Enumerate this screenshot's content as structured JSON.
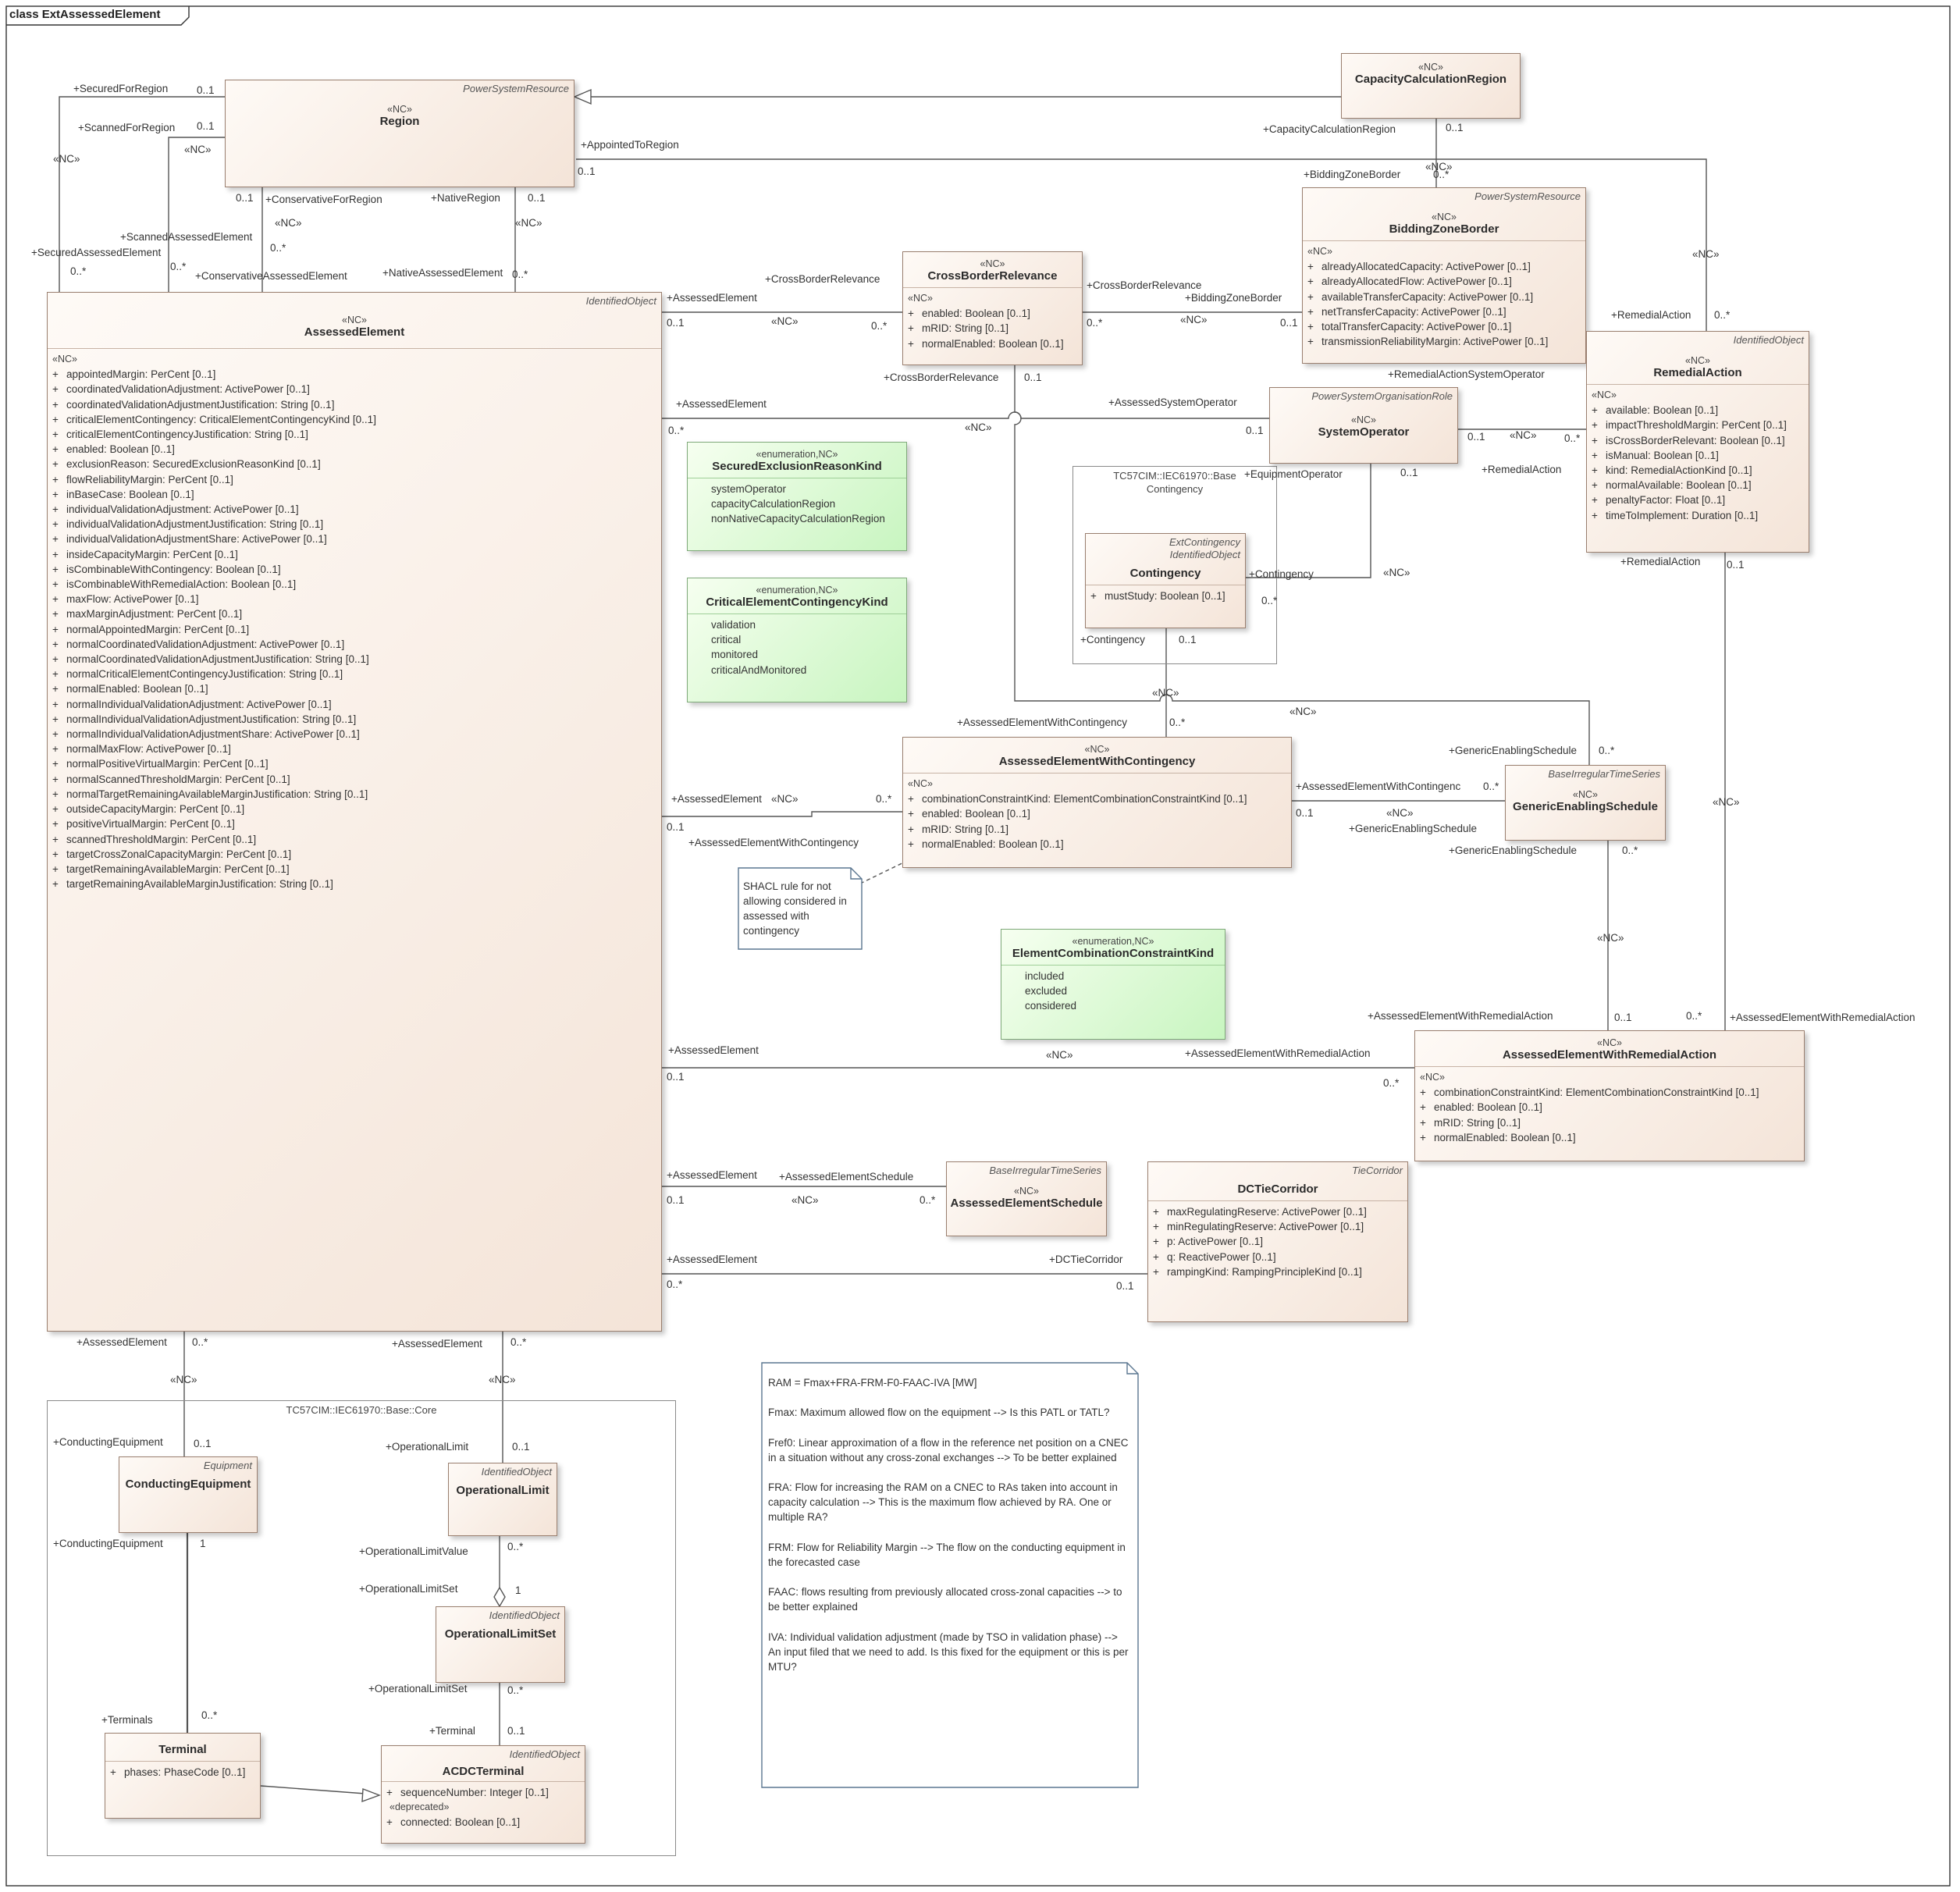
{
  "diagram_title": "class ExtAssessedElement",
  "classes": {
    "region": {
      "parent": "PowerSystemResource",
      "stereotype": "«NC»",
      "name": "Region"
    },
    "ccr": {
      "stereotype": "«NC»",
      "name": "CapacityCalculationRegion"
    },
    "bzb": {
      "parent": "PowerSystemResource",
      "stereotype": "«NC»",
      "name": "BiddingZoneBorder",
      "sec_stereo": "«NC»",
      "attrs": [
        {
          "vis": "+",
          "text": "alreadyAllocatedCapacity: ActivePower [0..1]"
        },
        {
          "vis": "+",
          "text": "alreadyAllocatedFlow: ActivePower [0..1]"
        },
        {
          "vis": "+",
          "text": "availableTransferCapacity: ActivePower [0..1]"
        },
        {
          "vis": "+",
          "text": "netTransferCapacity: ActivePower [0..1]"
        },
        {
          "vis": "+",
          "text": "totalTransferCapacity: ActivePower [0..1]"
        },
        {
          "vis": "+",
          "text": "transmissionReliabilityMargin: ActivePower [0..1]"
        }
      ]
    },
    "cbr": {
      "stereotype": "«NC»",
      "name": "CrossBorderRelevance",
      "sec_stereo": "«NC»",
      "attrs": [
        {
          "vis": "+",
          "text": "enabled: Boolean [0..1]"
        },
        {
          "vis": "+",
          "text": "mRID: String [0..1]"
        },
        {
          "vis": "+",
          "text": "normalEnabled: Boolean [0..1]"
        }
      ]
    },
    "ra": {
      "parent": "IdentifiedObject",
      "stereotype": "«NC»",
      "name": "RemedialAction",
      "sec_stereo": "«NC»",
      "attrs": [
        {
          "vis": "+",
          "text": "available: Boolean [0..1]"
        },
        {
          "vis": "+",
          "text": "impactThresholdMargin: PerCent [0..1]"
        },
        {
          "vis": "+",
          "text": "isCrossBorderRelevant: Boolean [0..1]"
        },
        {
          "vis": "+",
          "text": "isManual: Boolean [0..1]"
        },
        {
          "vis": "+",
          "text": "kind: RemedialActionKind [0..1]"
        },
        {
          "vis": "+",
          "text": "normalAvailable: Boolean [0..1]"
        },
        {
          "vis": "+",
          "text": "penaltyFactor: Float [0..1]"
        },
        {
          "vis": "+",
          "text": "timeToImplement: Duration [0..1]"
        }
      ]
    },
    "so": {
      "parent": "PowerSystemOrganisationRole",
      "stereotype": "«NC»",
      "name": "SystemOperator"
    },
    "ae": {
      "parent": "IdentifiedObject",
      "stereotype": "«NC»",
      "name": "AssessedElement",
      "sec_stereo": "«NC»",
      "attrs": [
        {
          "vis": "+",
          "text": "appointedMargin: PerCent [0..1]"
        },
        {
          "vis": "+",
          "text": "coordinatedValidationAdjustment: ActivePower [0..1]"
        },
        {
          "vis": "+",
          "text": "coordinatedValidationAdjustmentJustification: String [0..1]"
        },
        {
          "vis": "+",
          "text": "criticalElementContingency: CriticalElementContingencyKind [0..1]"
        },
        {
          "vis": "+",
          "text": "criticalElementContingencyJustification: String [0..1]"
        },
        {
          "vis": "+",
          "text": "enabled: Boolean [0..1]"
        },
        {
          "vis": "+",
          "text": "exclusionReason: SecuredExclusionReasonKind [0..1]"
        },
        {
          "vis": "+",
          "text": "flowReliabilityMargin: PerCent [0..1]"
        },
        {
          "vis": "+",
          "text": "inBaseCase: Boolean [0..1]"
        },
        {
          "vis": "+",
          "text": "individualValidationAdjustment: ActivePower [0..1]"
        },
        {
          "vis": "+",
          "text": "individualValidationAdjustmentJustification: String [0..1]"
        },
        {
          "vis": "+",
          "text": "individualValidationAdjustmentShare: ActivePower [0..1]"
        },
        {
          "vis": "+",
          "text": "insideCapacityMargin: PerCent [0..1]"
        },
        {
          "vis": "+",
          "text": "isCombinableWithContingency: Boolean [0..1]"
        },
        {
          "vis": "+",
          "text": "isCombinableWithRemedialAction: Boolean [0..1]"
        },
        {
          "vis": "+",
          "text": "maxFlow: ActivePower [0..1]"
        },
        {
          "vis": "+",
          "text": "maxMarginAdjustment: PerCent [0..1]"
        },
        {
          "vis": "+",
          "text": "normalAppointedMargin: PerCent [0..1]"
        },
        {
          "vis": "+",
          "text": "normalCoordinatedValidationAdjustment: ActivePower [0..1]"
        },
        {
          "vis": "+",
          "text": "normalCoordinatedValidationAdjustmentJustification: String [0..1]"
        },
        {
          "vis": "+",
          "text": "normalCriticalElementContingencyJustification: String [0..1]"
        },
        {
          "vis": "+",
          "text": "normalEnabled: Boolean [0..1]"
        },
        {
          "vis": "+",
          "text": "normalIndividualValidationAdjustment: ActivePower [0..1]"
        },
        {
          "vis": "+",
          "text": "normalIndividualValidationAdjustmentJustification: String [0..1]"
        },
        {
          "vis": "+",
          "text": "normalIndividualValidationAdjustmentShare: ActivePower [0..1]"
        },
        {
          "vis": "+",
          "text": "normalMaxFlow: ActivePower [0..1]"
        },
        {
          "vis": "+",
          "text": "normalPositiveVirtualMargin: PerCent [0..1]"
        },
        {
          "vis": "+",
          "text": "normalScannedThresholdMargin: PerCent [0..1]"
        },
        {
          "vis": "+",
          "text": "normalTargetRemainingAvailableMarginJustification: String [0..1]"
        },
        {
          "vis": "+",
          "text": "outsideCapacityMargin: PerCent [0..1]"
        },
        {
          "vis": "+",
          "text": "positiveVirtualMargin: PerCent [0..1]"
        },
        {
          "vis": "+",
          "text": "scannedThresholdMargin: PerCent [0..1]"
        },
        {
          "vis": "+",
          "text": "targetCrossZonalCapacityMargin: PerCent [0..1]"
        },
        {
          "vis": "+",
          "text": "targetRemainingAvailableMargin: PerCent [0..1]"
        },
        {
          "vis": "+",
          "text": "targetRemainingAvailableMarginJustification: String [0..1]"
        }
      ]
    },
    "sek": {
      "stereotype": "«enumeration,NC»",
      "name": "SecuredExclusionReasonKind",
      "literals": [
        "systemOperator",
        "capacityCalculationRegion",
        "nonNativeCapacityCalculationRegion"
      ]
    },
    "cek": {
      "stereotype": "«enumeration,NC»",
      "name": "CriticalElementContingencyKind",
      "literals": [
        "validation",
        "critical",
        "monitored",
        "criticalAndMonitored"
      ]
    },
    "cont": {
      "parent": "ExtContingency",
      "parent2": "IdentifiedObject",
      "name": "Contingency",
      "attrs": [
        {
          "vis": "+",
          "text": "mustStudy: Boolean [0..1]"
        }
      ]
    },
    "aewc": {
      "stereotype": "«NC»",
      "name": "AssessedElementWithContingency",
      "sec_stereo": "«NC»",
      "attrs": [
        {
          "vis": "+",
          "text": "combinationConstraintKind: ElementCombinationConstraintKind [0..1]"
        },
        {
          "vis": "+",
          "text": "enabled: Boolean [0..1]"
        },
        {
          "vis": "+",
          "text": "mRID: String [0..1]"
        },
        {
          "vis": "+",
          "text": "normalEnabled: Boolean [0..1]"
        }
      ]
    },
    "ges": {
      "parent": "BaseIrregularTimeSeries",
      "stereotype": "«NC»",
      "name": "GenericEnablingSchedule"
    },
    "ecck": {
      "stereotype": "«enumeration,NC»",
      "name": "ElementCombinationConstraintKind",
      "literals": [
        "included",
        "excluded",
        "considered"
      ]
    },
    "aewra": {
      "stereotype": "«NC»",
      "name": "AssessedElementWithRemedialAction",
      "sec_stereo": "«NC»",
      "attrs": [
        {
          "vis": "+",
          "text": "combinationConstraintKind: ElementCombinationConstraintKind [0..1]"
        },
        {
          "vis": "+",
          "text": "enabled: Boolean [0..1]"
        },
        {
          "vis": "+",
          "text": "mRID: String [0..1]"
        },
        {
          "vis": "+",
          "text": "normalEnabled: Boolean [0..1]"
        }
      ]
    },
    "aes": {
      "parent": "BaseIrregularTimeSeries",
      "stereotype": "«NC»",
      "name": "AssessedElementSchedule"
    },
    "dctc": {
      "parent": "TieCorridor",
      "name": "DCTieCorridor",
      "attrs": [
        {
          "vis": "+",
          "text": "maxRegulatingReserve: ActivePower [0..1]"
        },
        {
          "vis": "+",
          "text": "minRegulatingReserve: ActivePower [0..1]"
        },
        {
          "vis": "+",
          "text": "p: ActivePower [0..1]"
        },
        {
          "vis": "+",
          "text": "q: ReactivePower [0..1]"
        },
        {
          "vis": "+",
          "text": "rampingKind: RampingPrincipleKind [0..1]"
        }
      ]
    },
    "ce": {
      "parent": "Equipment",
      "name": "ConductingEquipment"
    },
    "ol": {
      "parent": "IdentifiedObject",
      "name": "OperationalLimit"
    },
    "ols": {
      "parent": "IdentifiedObject",
      "name": "OperationalLimitSet"
    },
    "term": {
      "name": "Terminal",
      "attrs": [
        {
          "vis": "+",
          "text": "phases: PhaseCode [0..1]"
        }
      ]
    },
    "acdc": {
      "parent": "IdentifiedObject",
      "name": "ACDCTerminal",
      "attrs": [
        {
          "vis": "+",
          "text": "sequenceNumber: Integer [0..1]"
        }
      ],
      "deprecated_stereo": "«deprecated»",
      "attrs2": [
        {
          "vis": "+",
          "text": "connected: Boolean [0..1]"
        }
      ]
    }
  },
  "packages": {
    "base_contingency": {
      "line1": "TC57CIM::IEC61970::Base",
      "line2": "Contingency"
    },
    "base_core": {
      "title": "TC57CIM::IEC61970::Base::Core"
    }
  },
  "notes": {
    "shacl": "SHACL rule for not allowing considered in assessed with contingency",
    "ram": [
      "RAM = Fmax+FRA-FRM-F0-FAAC-IVA [MW]",
      "Fmax: Maximum allowed flow on the equipment --> Is this PATL or TATL?",
      "Fref0: Linear approximation of a flow in the reference net position on a CNEC in a situation without any cross-zonal exchanges --> To be better explained",
      "FRA: Flow for increasing the RAM on a CNEC to RAs taken into account in capacity calculation -->  This is the maximum flow achieved by RA. One or multiple RA?",
      "FRM: Flow for Reliability Margin --> The flow on the conducting equipment in the forecasted case",
      "FAAC: flows resulting from previously allocated cross-zonal capacities --> to be better explained",
      "IVA: Individual validation adjustment (made by TSO in validation phase) --> An input filed that we need to add. Is this fixed for the equipment or this is per MTU?"
    ]
  },
  "labels": [
    {
      "t": "+SecuredForRegion",
      "n": "role"
    },
    {
      "t": "0..1",
      "n": "mult"
    },
    {
      "t": "+ScannedForRegion",
      "n": "role"
    },
    {
      "t": "0..1",
      "n": "mult"
    },
    {
      "t": "«NC»",
      "n": "stereo"
    },
    {
      "t": "«NC»",
      "n": "stereo"
    },
    {
      "t": "+SecuredAssessedElement",
      "n": "role"
    },
    {
      "t": "0..*",
      "n": "mult"
    },
    {
      "t": "+ScannedAssessedElement",
      "n": "role"
    },
    {
      "t": "0..*",
      "n": "mult"
    },
    {
      "t": "0..1",
      "n": "mult"
    },
    {
      "t": "+ConservativeForRegion",
      "n": "role"
    },
    {
      "t": "«NC»",
      "n": "stereo"
    },
    {
      "t": "0..*",
      "n": "mult"
    },
    {
      "t": "+ConservativeAssessedElement",
      "n": "role"
    },
    {
      "t": "+NativeRegion",
      "n": "role"
    },
    {
      "t": "0..1",
      "n": "mult"
    },
    {
      "t": "«NC»",
      "n": "stereo"
    },
    {
      "t": "+NativeAssessedElement",
      "n": "role"
    },
    {
      "t": "0..*",
      "n": "mult"
    },
    {
      "t": "+AppointedToRegion",
      "n": "role"
    },
    {
      "t": "0..1",
      "n": "mult"
    },
    {
      "t": "+CapacityCalculationRegion",
      "n": "role"
    },
    {
      "t": "0..1",
      "n": "mult"
    },
    {
      "t": "«NC»",
      "n": "stereo"
    },
    {
      "t": "+BiddingZoneBorder",
      "n": "role"
    },
    {
      "t": "0..*",
      "n": "mult"
    },
    {
      "t": "«NC»",
      "n": "stereo"
    },
    {
      "t": "+AssessedElement",
      "n": "role"
    },
    {
      "t": "0..1",
      "n": "mult"
    },
    {
      "t": "+CrossBorderRelevance",
      "n": "role"
    },
    {
      "t": "«NC»",
      "n": "stereo"
    },
    {
      "t": "0..*",
      "n": "mult"
    },
    {
      "t": "+CrossBorderRelevance",
      "n": "role"
    },
    {
      "t": "0..*",
      "n": "mult"
    },
    {
      "t": "+BiddingZoneBorder",
      "n": "role"
    },
    {
      "t": "«NC»",
      "n": "stereo"
    },
    {
      "t": "0..1",
      "n": "mult"
    },
    {
      "t": "+CrossBorderRelevance",
      "n": "role"
    },
    {
      "t": "0..1",
      "n": "mult"
    },
    {
      "t": "+RemedialAction",
      "n": "role"
    },
    {
      "t": "0..*",
      "n": "mult"
    },
    {
      "t": "+RemedialActionSystemOperator",
      "n": "role"
    },
    {
      "t": "+AssessedElement",
      "n": "role"
    },
    {
      "t": "0..*",
      "n": "mult"
    },
    {
      "t": "«NC»",
      "n": "stereo"
    },
    {
      "t": "+AssessedSystemOperator",
      "n": "role"
    },
    {
      "t": "0..1",
      "n": "mult"
    },
    {
      "t": "0..1",
      "n": "mult"
    },
    {
      "t": "«NC»",
      "n": "stereo"
    },
    {
      "t": "0..*",
      "n": "mult"
    },
    {
      "t": "+RemedialAction",
      "n": "role"
    },
    {
      "t": "+EquipmentOperator",
      "n": "role"
    },
    {
      "t": "0..1",
      "n": "mult"
    },
    {
      "t": "+Contingency",
      "n": "role"
    },
    {
      "t": "0..*",
      "n": "mult"
    },
    {
      "t": "«NC»",
      "n": "stereo"
    },
    {
      "t": "+Contingency",
      "n": "role"
    },
    {
      "t": "0..1",
      "n": "mult"
    },
    {
      "t": "+RemedialAction",
      "n": "role"
    },
    {
      "t": "0..1",
      "n": "mult"
    },
    {
      "t": "«NC»",
      "n": "stereo"
    },
    {
      "t": "«NC»",
      "n": "stereo"
    },
    {
      "t": "+AssessedElementWithContingency",
      "n": "role"
    },
    {
      "t": "0..*",
      "n": "mult"
    },
    {
      "t": "+GenericEnablingSchedule",
      "n": "role"
    },
    {
      "t": "0..*",
      "n": "mult"
    },
    {
      "t": "+AssessedElement",
      "n": "role"
    },
    {
      "t": "«NC»",
      "n": "stereo"
    },
    {
      "t": "0..*",
      "n": "mult"
    },
    {
      "t": "0..1",
      "n": "mult"
    },
    {
      "t": "+AssessedElementWithContingency",
      "n": "role"
    },
    {
      "t": "+AssessedElementWithContingenc",
      "n": "role"
    },
    {
      "t": "0..*",
      "n": "mult"
    },
    {
      "t": "0..1",
      "n": "mult"
    },
    {
      "t": "«NC»",
      "n": "stereo"
    },
    {
      "t": "+GenericEnablingSchedule",
      "n": "role"
    },
    {
      "t": "+GenericEnablingSchedule",
      "n": "role"
    },
    {
      "t": "0..*",
      "n": "mult"
    },
    {
      "t": "«NC»",
      "n": "stereo"
    },
    {
      "t": "«NC»",
      "n": "stereo"
    },
    {
      "t": "+AssessedElementWithRemedialAction",
      "n": "role"
    },
    {
      "t": "0..1",
      "n": "mult"
    },
    {
      "t": "0..*",
      "n": "mult"
    },
    {
      "t": "+AssessedElementWithRemedialAction",
      "n": "role"
    },
    {
      "t": "+AssessedElement",
      "n": "role"
    },
    {
      "t": "0..1",
      "n": "mult"
    },
    {
      "t": "«NC»",
      "n": "stereo"
    },
    {
      "t": "+AssessedElementWithRemedialAction",
      "n": "role"
    },
    {
      "t": "0..*",
      "n": "mult"
    },
    {
      "t": "+AssessedElement",
      "n": "role"
    },
    {
      "t": "0..1",
      "n": "mult"
    },
    {
      "t": "+AssessedElementSchedule",
      "n": "role"
    },
    {
      "t": "«NC»",
      "n": "stereo"
    },
    {
      "t": "0..*",
      "n": "mult"
    },
    {
      "t": "+AssessedElement",
      "n": "role"
    },
    {
      "t": "0..*",
      "n": "mult"
    },
    {
      "t": "+DCTieCorridor",
      "n": "role"
    },
    {
      "t": "0..1",
      "n": "mult"
    },
    {
      "t": "+AssessedElement",
      "n": "role"
    },
    {
      "t": "0..*",
      "n": "mult"
    },
    {
      "t": "«NC»",
      "n": "stereo"
    },
    {
      "t": "+AssessedElement",
      "n": "role"
    },
    {
      "t": "0..*",
      "n": "mult"
    },
    {
      "t": "«NC»",
      "n": "stereo"
    },
    {
      "t": "+ConductingEquipment",
      "n": "role"
    },
    {
      "t": "0..1",
      "n": "mult"
    },
    {
      "t": "+OperationalLimit",
      "n": "role"
    },
    {
      "t": "0..1",
      "n": "mult"
    },
    {
      "t": "+ConductingEquipment",
      "n": "role"
    },
    {
      "t": "1",
      "n": "mult"
    },
    {
      "t": "+OperationalLimitValue",
      "n": "role"
    },
    {
      "t": "0..*",
      "n": "mult"
    },
    {
      "t": "+OperationalLimitSet",
      "n": "role"
    },
    {
      "t": "1",
      "n": "mult"
    },
    {
      "t": "+OperationalLimitSet",
      "n": "role"
    },
    {
      "t": "0..*",
      "n": "mult"
    },
    {
      "t": "+Terminals",
      "n": "role"
    },
    {
      "t": "0..*",
      "n": "mult"
    },
    {
      "t": "+Terminal",
      "n": "role"
    },
    {
      "t": "0..1",
      "n": "mult"
    }
  ]
}
